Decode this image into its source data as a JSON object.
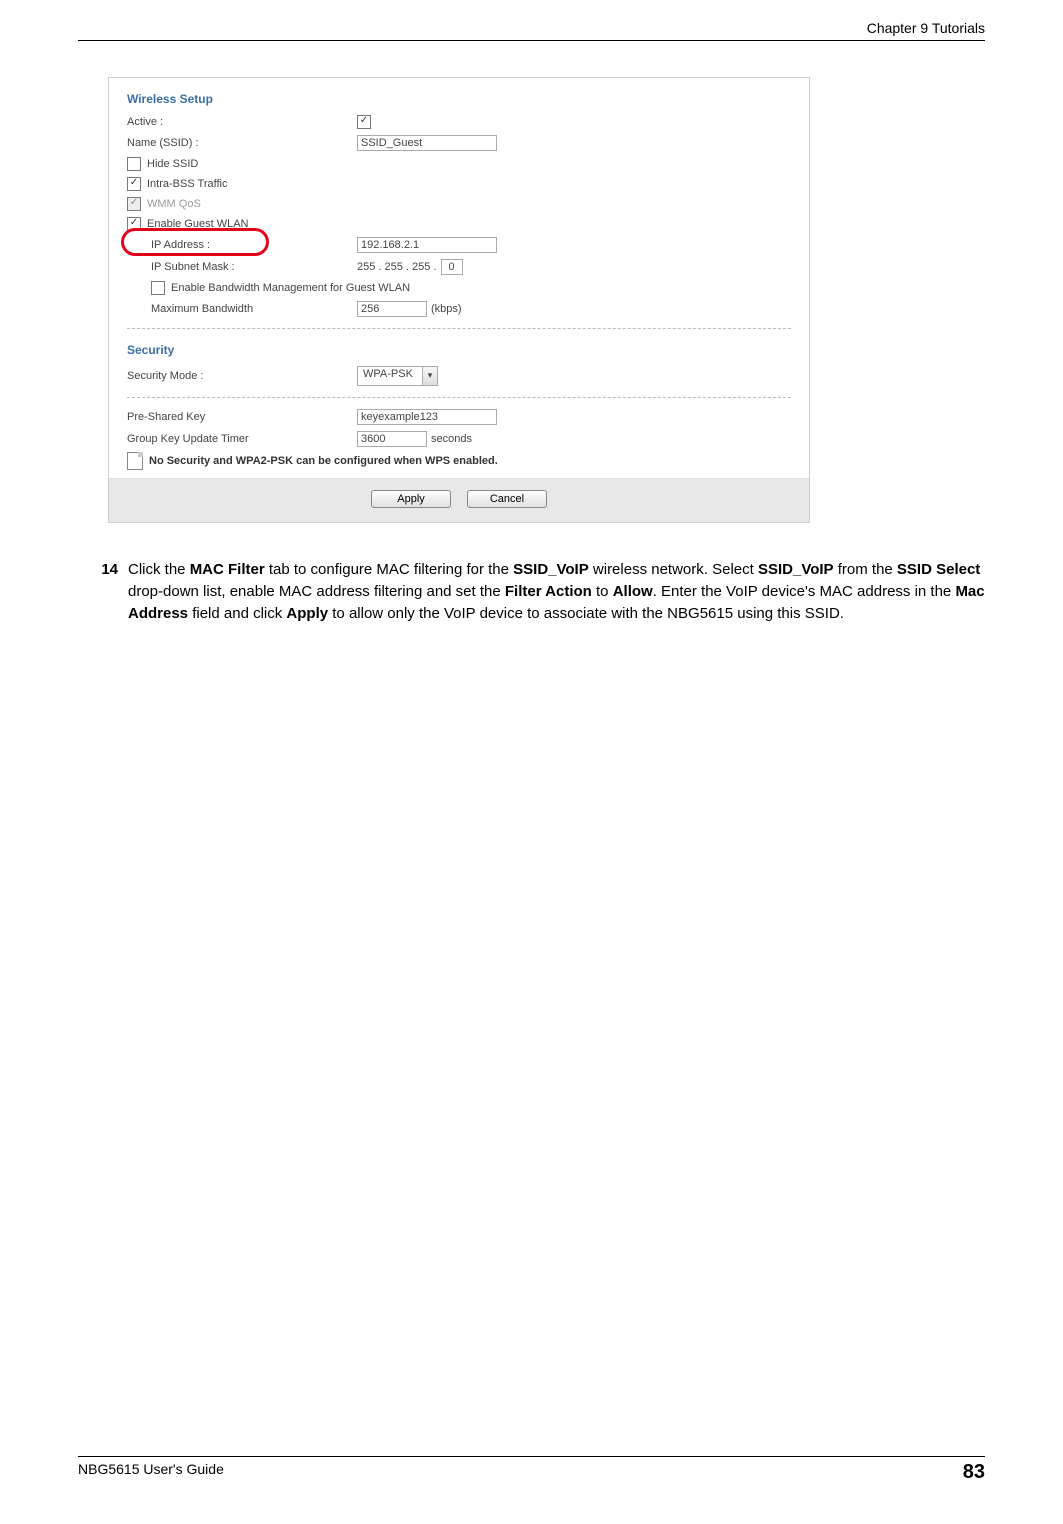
{
  "header": {
    "chapter": "Chapter 9 Tutorials"
  },
  "screenshot": {
    "wireless_setup": {
      "title": "Wireless Setup",
      "active_label": "Active :",
      "active_checked": true,
      "name_label": "Name (SSID) :",
      "name_value": "SSID_Guest",
      "hide_ssid": {
        "label": "Hide SSID",
        "checked": false
      },
      "intra_bss": {
        "label": "Intra-BSS Traffic",
        "checked": true
      },
      "wmm_qos": {
        "label": "WMM QoS",
        "checked": true,
        "disabled": true
      },
      "enable_guest": {
        "label": "Enable Guest WLAN",
        "checked": true,
        "highlighted": true
      },
      "ip_label": "IP Address :",
      "ip_value": "192.168.2.1",
      "subnet_label": "IP Subnet Mask :",
      "subnet_prefix": "255 . 255 . 255 .",
      "subnet_last": "0",
      "bw_mgmt": {
        "label": "Enable Bandwidth Management for Guest WLAN",
        "checked": false
      },
      "max_bw_label": "Maximum Bandwidth",
      "max_bw_value": "256",
      "max_bw_unit": "(kbps)"
    },
    "security": {
      "title": "Security",
      "mode_label": "Security Mode :",
      "mode_value": "WPA-PSK",
      "psk_label": "Pre-Shared Key",
      "psk_value": "keyexample123",
      "gku_label": "Group Key Update Timer",
      "gku_value": "3600",
      "gku_unit": "seconds",
      "note": "No Security and WPA2-PSK can be configured when WPS enabled."
    },
    "buttons": {
      "apply": "Apply",
      "cancel": "Cancel"
    }
  },
  "step": {
    "number": "14",
    "sentence_parts": {
      "p1": "Click the ",
      "b1": "MAC Filter",
      "p2": " tab to configure MAC filtering for the ",
      "b2": "SSID_VoIP",
      "p3": " wireless network. Select ",
      "b3": "SSID_VoIP",
      "p4": " from the ",
      "b4": "SSID Select",
      "p5": " drop-down list, enable MAC address filtering and set the ",
      "b5": "Filter Action",
      "p6": " to ",
      "b6": "Allow",
      "p7": ". Enter the VoIP device's MAC address in the ",
      "b7": "Mac Address",
      "p8": " field and click ",
      "b8": "Apply",
      "p9": " to allow only the VoIP device to associate with the NBG5615 using this SSID."
    }
  },
  "footer": {
    "left": "NBG5615 User's Guide",
    "right": "83"
  }
}
